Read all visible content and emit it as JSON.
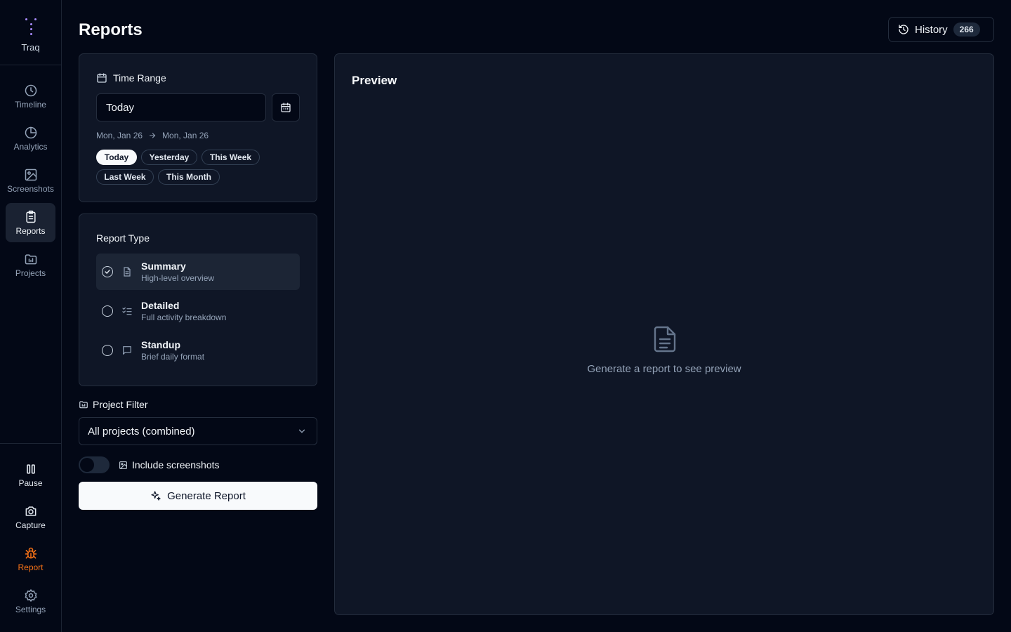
{
  "app": {
    "name": "Traq"
  },
  "sidebar": {
    "items": [
      {
        "label": "Timeline",
        "icon": "clock-icon"
      },
      {
        "label": "Analytics",
        "icon": "pie-chart-icon"
      },
      {
        "label": "Screenshots",
        "icon": "image-icon"
      },
      {
        "label": "Reports",
        "icon": "clipboard-icon",
        "active": true
      },
      {
        "label": "Projects",
        "icon": "folder-icon"
      }
    ],
    "bottom": [
      {
        "label": "Pause",
        "icon": "pause-icon"
      },
      {
        "label": "Capture",
        "icon": "camera-icon"
      },
      {
        "label": "Report",
        "icon": "bug-icon",
        "color": "#f97316"
      },
      {
        "label": "Settings",
        "icon": "gear-icon"
      }
    ]
  },
  "header": {
    "title": "Reports",
    "history": {
      "label": "History",
      "count": "266"
    }
  },
  "time_range": {
    "title": "Time Range",
    "value": "Today",
    "from": "Mon, Jan 26",
    "to": "Mon, Jan 26",
    "presets": [
      "Today",
      "Yesterday",
      "This Week",
      "Last Week",
      "This Month"
    ],
    "active_preset": "Today"
  },
  "report_type": {
    "title": "Report Type",
    "options": [
      {
        "name": "Summary",
        "desc": "High-level overview",
        "selected": true
      },
      {
        "name": "Detailed",
        "desc": "Full activity breakdown",
        "selected": false
      },
      {
        "name": "Standup",
        "desc": "Brief daily format",
        "selected": false
      }
    ]
  },
  "project_filter": {
    "label": "Project Filter",
    "selected": "All projects (combined)"
  },
  "include_screenshots": {
    "label": "Include screenshots",
    "enabled": false
  },
  "generate": {
    "label": "Generate Report"
  },
  "preview": {
    "title": "Preview",
    "empty_message": "Generate a report to see preview"
  },
  "colors": {
    "accent": "#a78bfa",
    "report_orange": "#f97316",
    "background": "#030816",
    "card": "#0f1626"
  }
}
